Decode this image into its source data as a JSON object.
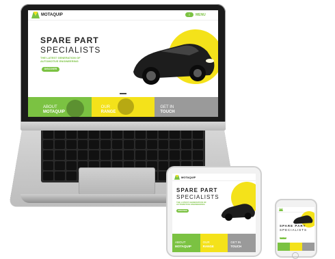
{
  "brand": {
    "name": "MOTAQUIP",
    "accent": "#7bc242",
    "yellow": "#f4e21a"
  },
  "header": {
    "menu_label": "MENU"
  },
  "hero": {
    "title_line1": "SPARE PART",
    "title_line2": "SPECIALISTS",
    "subtitle": "THE LATEST GENERATION OF AUTOMOTIVE ENGINEERING",
    "cta_label": "DISCOVER"
  },
  "tiles": [
    {
      "line1": "ABOUT",
      "line2": "MOTAQUIP"
    },
    {
      "line1": "OUR",
      "line2": "RANGE"
    },
    {
      "line1": "GET IN",
      "line2": "TOUCH"
    }
  ],
  "icons": {
    "logo": "motaquip-logo-icon",
    "car": "car-icon",
    "menu": "hamburger-menu-icon"
  }
}
